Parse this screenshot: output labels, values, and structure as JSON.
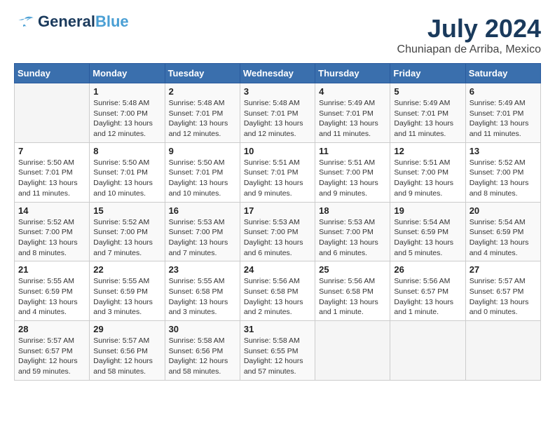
{
  "header": {
    "logo_general": "General",
    "logo_blue": "Blue",
    "main_title": "July 2024",
    "subtitle": "Chuniapan de Arriba, Mexico"
  },
  "calendar": {
    "days_of_week": [
      "Sunday",
      "Monday",
      "Tuesday",
      "Wednesday",
      "Thursday",
      "Friday",
      "Saturday"
    ],
    "weeks": [
      [
        {
          "day": "",
          "info": ""
        },
        {
          "day": "1",
          "info": "Sunrise: 5:48 AM\nSunset: 7:00 PM\nDaylight: 13 hours\nand 12 minutes."
        },
        {
          "day": "2",
          "info": "Sunrise: 5:48 AM\nSunset: 7:01 PM\nDaylight: 13 hours\nand 12 minutes."
        },
        {
          "day": "3",
          "info": "Sunrise: 5:48 AM\nSunset: 7:01 PM\nDaylight: 13 hours\nand 12 minutes."
        },
        {
          "day": "4",
          "info": "Sunrise: 5:49 AM\nSunset: 7:01 PM\nDaylight: 13 hours\nand 11 minutes."
        },
        {
          "day": "5",
          "info": "Sunrise: 5:49 AM\nSunset: 7:01 PM\nDaylight: 13 hours\nand 11 minutes."
        },
        {
          "day": "6",
          "info": "Sunrise: 5:49 AM\nSunset: 7:01 PM\nDaylight: 13 hours\nand 11 minutes."
        }
      ],
      [
        {
          "day": "7",
          "info": "Sunrise: 5:50 AM\nSunset: 7:01 PM\nDaylight: 13 hours\nand 11 minutes."
        },
        {
          "day": "8",
          "info": "Sunrise: 5:50 AM\nSunset: 7:01 PM\nDaylight: 13 hours\nand 10 minutes."
        },
        {
          "day": "9",
          "info": "Sunrise: 5:50 AM\nSunset: 7:01 PM\nDaylight: 13 hours\nand 10 minutes."
        },
        {
          "day": "10",
          "info": "Sunrise: 5:51 AM\nSunset: 7:01 PM\nDaylight: 13 hours\nand 9 minutes."
        },
        {
          "day": "11",
          "info": "Sunrise: 5:51 AM\nSunset: 7:00 PM\nDaylight: 13 hours\nand 9 minutes."
        },
        {
          "day": "12",
          "info": "Sunrise: 5:51 AM\nSunset: 7:00 PM\nDaylight: 13 hours\nand 9 minutes."
        },
        {
          "day": "13",
          "info": "Sunrise: 5:52 AM\nSunset: 7:00 PM\nDaylight: 13 hours\nand 8 minutes."
        }
      ],
      [
        {
          "day": "14",
          "info": "Sunrise: 5:52 AM\nSunset: 7:00 PM\nDaylight: 13 hours\nand 8 minutes."
        },
        {
          "day": "15",
          "info": "Sunrise: 5:52 AM\nSunset: 7:00 PM\nDaylight: 13 hours\nand 7 minutes."
        },
        {
          "day": "16",
          "info": "Sunrise: 5:53 AM\nSunset: 7:00 PM\nDaylight: 13 hours\nand 7 minutes."
        },
        {
          "day": "17",
          "info": "Sunrise: 5:53 AM\nSunset: 7:00 PM\nDaylight: 13 hours\nand 6 minutes."
        },
        {
          "day": "18",
          "info": "Sunrise: 5:53 AM\nSunset: 7:00 PM\nDaylight: 13 hours\nand 6 minutes."
        },
        {
          "day": "19",
          "info": "Sunrise: 5:54 AM\nSunset: 6:59 PM\nDaylight: 13 hours\nand 5 minutes."
        },
        {
          "day": "20",
          "info": "Sunrise: 5:54 AM\nSunset: 6:59 PM\nDaylight: 13 hours\nand 4 minutes."
        }
      ],
      [
        {
          "day": "21",
          "info": "Sunrise: 5:55 AM\nSunset: 6:59 PM\nDaylight: 13 hours\nand 4 minutes."
        },
        {
          "day": "22",
          "info": "Sunrise: 5:55 AM\nSunset: 6:59 PM\nDaylight: 13 hours\nand 3 minutes."
        },
        {
          "day": "23",
          "info": "Sunrise: 5:55 AM\nSunset: 6:58 PM\nDaylight: 13 hours\nand 3 minutes."
        },
        {
          "day": "24",
          "info": "Sunrise: 5:56 AM\nSunset: 6:58 PM\nDaylight: 13 hours\nand 2 minutes."
        },
        {
          "day": "25",
          "info": "Sunrise: 5:56 AM\nSunset: 6:58 PM\nDaylight: 13 hours\nand 1 minute."
        },
        {
          "day": "26",
          "info": "Sunrise: 5:56 AM\nSunset: 6:57 PM\nDaylight: 13 hours\nand 1 minute."
        },
        {
          "day": "27",
          "info": "Sunrise: 5:57 AM\nSunset: 6:57 PM\nDaylight: 13 hours\nand 0 minutes."
        }
      ],
      [
        {
          "day": "28",
          "info": "Sunrise: 5:57 AM\nSunset: 6:57 PM\nDaylight: 12 hours\nand 59 minutes."
        },
        {
          "day": "29",
          "info": "Sunrise: 5:57 AM\nSunset: 6:56 PM\nDaylight: 12 hours\nand 58 minutes."
        },
        {
          "day": "30",
          "info": "Sunrise: 5:58 AM\nSunset: 6:56 PM\nDaylight: 12 hours\nand 58 minutes."
        },
        {
          "day": "31",
          "info": "Sunrise: 5:58 AM\nSunset: 6:55 PM\nDaylight: 12 hours\nand 57 minutes."
        },
        {
          "day": "",
          "info": ""
        },
        {
          "day": "",
          "info": ""
        },
        {
          "day": "",
          "info": ""
        }
      ]
    ]
  }
}
